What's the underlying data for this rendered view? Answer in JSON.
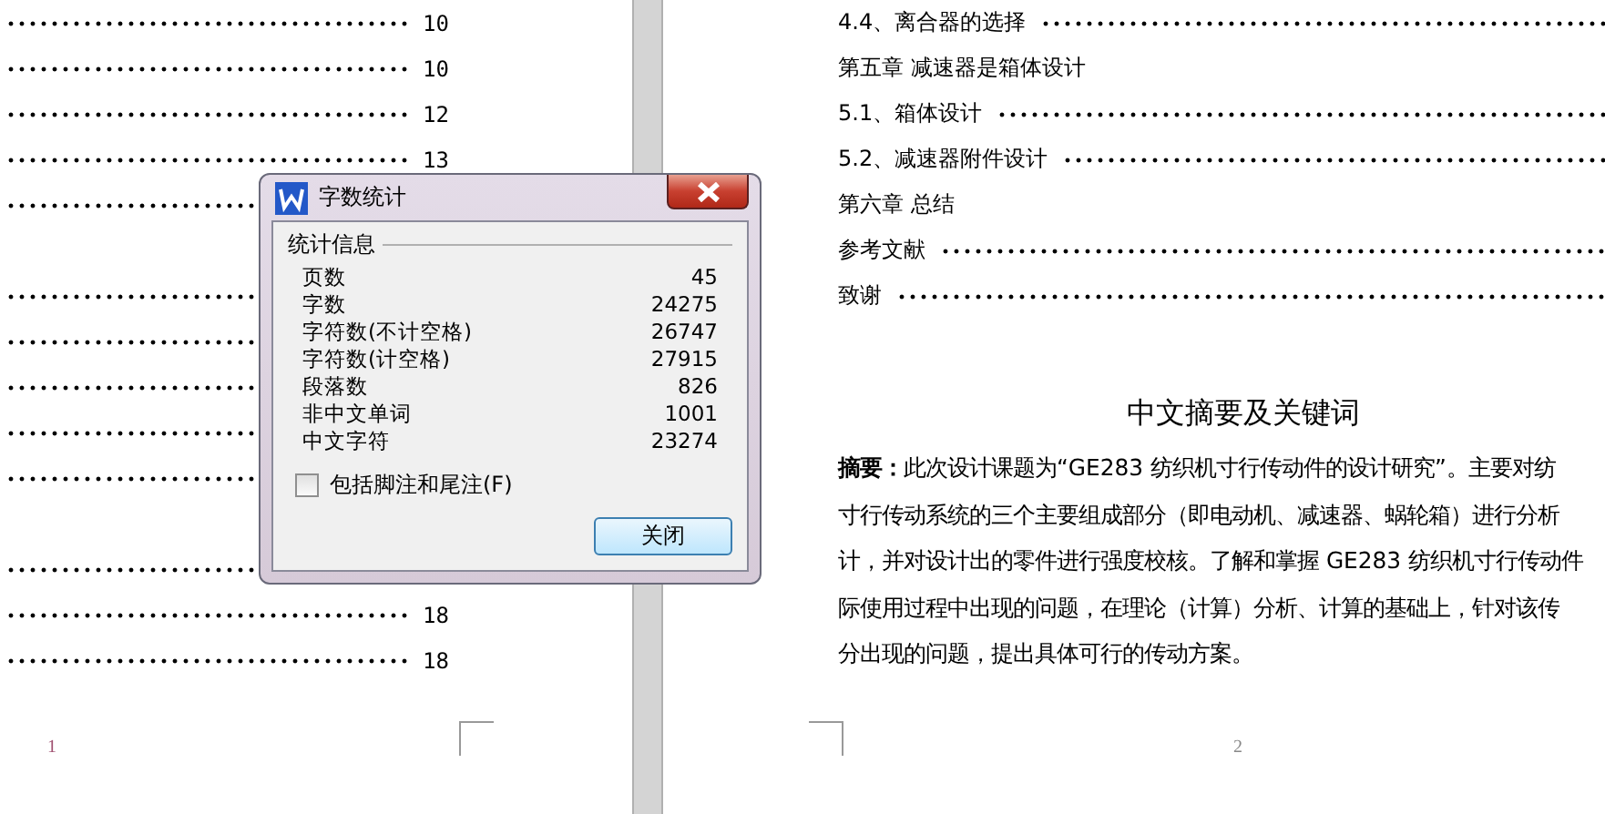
{
  "left_page": {
    "toc_rows": [
      {
        "kind": "entry",
        "page": "10"
      },
      {
        "kind": "entry",
        "page": "10"
      },
      {
        "kind": "entry",
        "page": "12"
      },
      {
        "kind": "entry",
        "page": "13"
      },
      {
        "kind": "entry"
      },
      {
        "kind": "blank"
      },
      {
        "kind": "entry"
      },
      {
        "kind": "entry"
      },
      {
        "kind": "entry"
      },
      {
        "kind": "entry"
      },
      {
        "kind": "entry"
      },
      {
        "kind": "blank"
      },
      {
        "kind": "entry"
      },
      {
        "kind": "entry",
        "page": "18"
      },
      {
        "kind": "entry",
        "page": "18"
      }
    ],
    "page_number": "1"
  },
  "right_page": {
    "toc_rows": [
      {
        "kind": "entry",
        "title": "4.4、离合器的选择"
      },
      {
        "kind": "chapter",
        "title": "第五章 减速器是箱体设计"
      },
      {
        "kind": "entry",
        "title": "5.1、箱体设计"
      },
      {
        "kind": "entry",
        "title": "5.2、减速器附件设计"
      },
      {
        "kind": "chapter",
        "title": "第六章 总结"
      },
      {
        "kind": "entry",
        "title": "参考文献"
      },
      {
        "kind": "entry",
        "title": "致谢"
      }
    ],
    "heading": "中文摘要及关键词",
    "abstract_lines": [
      "**摘要：**此次设计课题为“GE283 纺织机寸行传动件的设计研究”。主要对纺",
      "寸行传动系统的三个主要组成部分（即电动机、减速器、蜗轮箱）进行分析",
      "计，并对设计出的零件进行强度校核。了解和掌握 GE283 纺织机寸行传动件",
      "际使用过程中出现的问题，在理论（计算）分析、计算的基础上，针对该传",
      "分出现的问题，提出具体可行的传动方案。"
    ],
    "page_number": "2"
  },
  "dialog": {
    "title": "字数统计",
    "group": "统计信息",
    "stats": [
      {
        "label": "页数",
        "value": "45"
      },
      {
        "label": "字数",
        "value": "24275"
      },
      {
        "label": "字符数(不计空格)",
        "value": "26747"
      },
      {
        "label": "字符数(计空格)",
        "value": "27915"
      },
      {
        "label": "段落数",
        "value": "826"
      },
      {
        "label": "非中文单词",
        "value": "1001"
      },
      {
        "label": "中文字符",
        "value": "23274"
      }
    ],
    "checkbox": {
      "label": "包括脚注和尾注(F)",
      "checked": false
    },
    "button": "关闭"
  }
}
